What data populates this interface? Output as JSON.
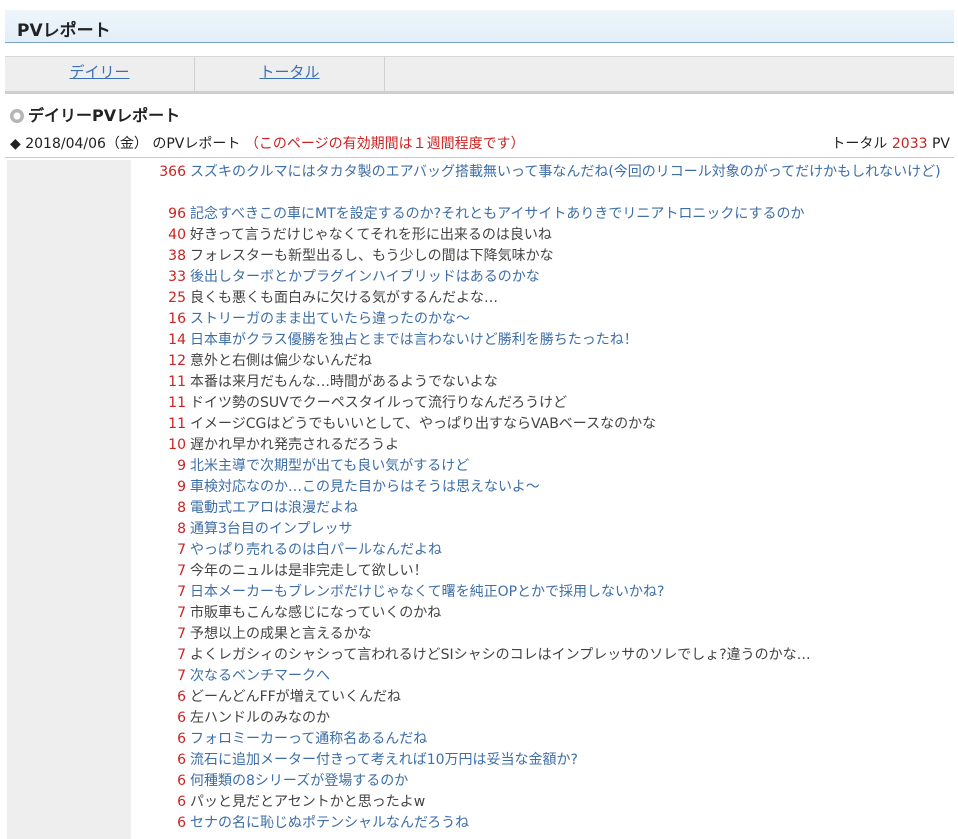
{
  "header": {
    "title": "PVレポート"
  },
  "tabs": [
    {
      "label": "デイリー"
    },
    {
      "label": "トータル"
    }
  ],
  "section": {
    "title": "デイリーPVレポート",
    "date_line": "◆ 2018/04/06（金） のPVレポート",
    "note": "（このページの有効期間は１週間程度です）",
    "total_label": "トータル",
    "total_value": "2033",
    "total_unit": "PV"
  },
  "items": [
    {
      "count": "366",
      "text": "スズキのクルマにはタカタ製のエアバッグ搭載無いって事なんだね(今回のリコール対象のがってだけかもしれないけど)"
    },
    {
      "count": "96",
      "text": "記念すべきこの車にMTを設定するのか?それともアイサイトありきでリニアトロニックにするのか"
    },
    {
      "count": "40",
      "text": "好きって言うだけじゃなくてそれを形に出来るのは良いね"
    },
    {
      "count": "38",
      "text": "フォレスターも新型出るし、もう少しの間は下降気味かな"
    },
    {
      "count": "33",
      "text": "後出しターボとかプラグインハイブリッドはあるのかな"
    },
    {
      "count": "25",
      "text": "良くも悪くも面白みに欠ける気がするんだよな…"
    },
    {
      "count": "16",
      "text": "ストリーガのまま出ていたら違ったのかな～"
    },
    {
      "count": "14",
      "text": "日本車がクラス優勝を独占とまでは言わないけど勝利を勝ちたったね！"
    },
    {
      "count": "12",
      "text": "意外と右側は偏少ないんだね"
    },
    {
      "count": "11",
      "text": "本番は来月だもんな…時間があるようでないよな"
    },
    {
      "count": "11",
      "text": "ドイツ勢のSUVでクーペスタイルって流行りなんだろうけど"
    },
    {
      "count": "11",
      "text": "イメージCGはどうでもいいとして、やっぱり出すならVABベースなのかな"
    },
    {
      "count": "10",
      "text": "遅かれ早かれ発売されるだろうよ"
    },
    {
      "count": "9",
      "text": "北米主導で次期型が出ても良い気がするけど"
    },
    {
      "count": "9",
      "text": "車検対応なのか…この見た目からはそうは思えないよ～"
    },
    {
      "count": "8",
      "text": "電動式エアロは浪漫だよね"
    },
    {
      "count": "8",
      "text": "通算3台目のインプレッサ"
    },
    {
      "count": "7",
      "text": "やっぱり売れるのは白パールなんだよね"
    },
    {
      "count": "7",
      "text": "今年のニュルは是非完走して欲しい！"
    },
    {
      "count": "7",
      "text": "日本メーカーもブレンボだけじゃなくて曙を純正OPとかで採用しないかね?"
    },
    {
      "count": "7",
      "text": "市販車もこんな感じになっていくのかね"
    },
    {
      "count": "7",
      "text": "予想以上の成果と言えるかな"
    },
    {
      "count": "7",
      "text": "よくレガシィのシャシって言われるけどSIシャシのコレはインプレッサのソレでしょ?違うのかな…"
    },
    {
      "count": "7",
      "text": "次なるベンチマークへ"
    },
    {
      "count": "6",
      "text": "どーんどんFFが増えていくんだね"
    },
    {
      "count": "6",
      "text": "左ハンドルのみなのか"
    },
    {
      "count": "6",
      "text": "フォロミーカーって通称名あるんだね"
    },
    {
      "count": "6",
      "text": "流石に追加メーター付きって考えれば10万円は妥当な金額か?"
    },
    {
      "count": "6",
      "text": "何種類の8シリーズが登場するのか"
    },
    {
      "count": "6",
      "text": "パッと見だとアセントかと思ったよw"
    },
    {
      "count": "6",
      "text": "セナの名に恥じぬポテンシャルなんだろうね"
    }
  ]
}
